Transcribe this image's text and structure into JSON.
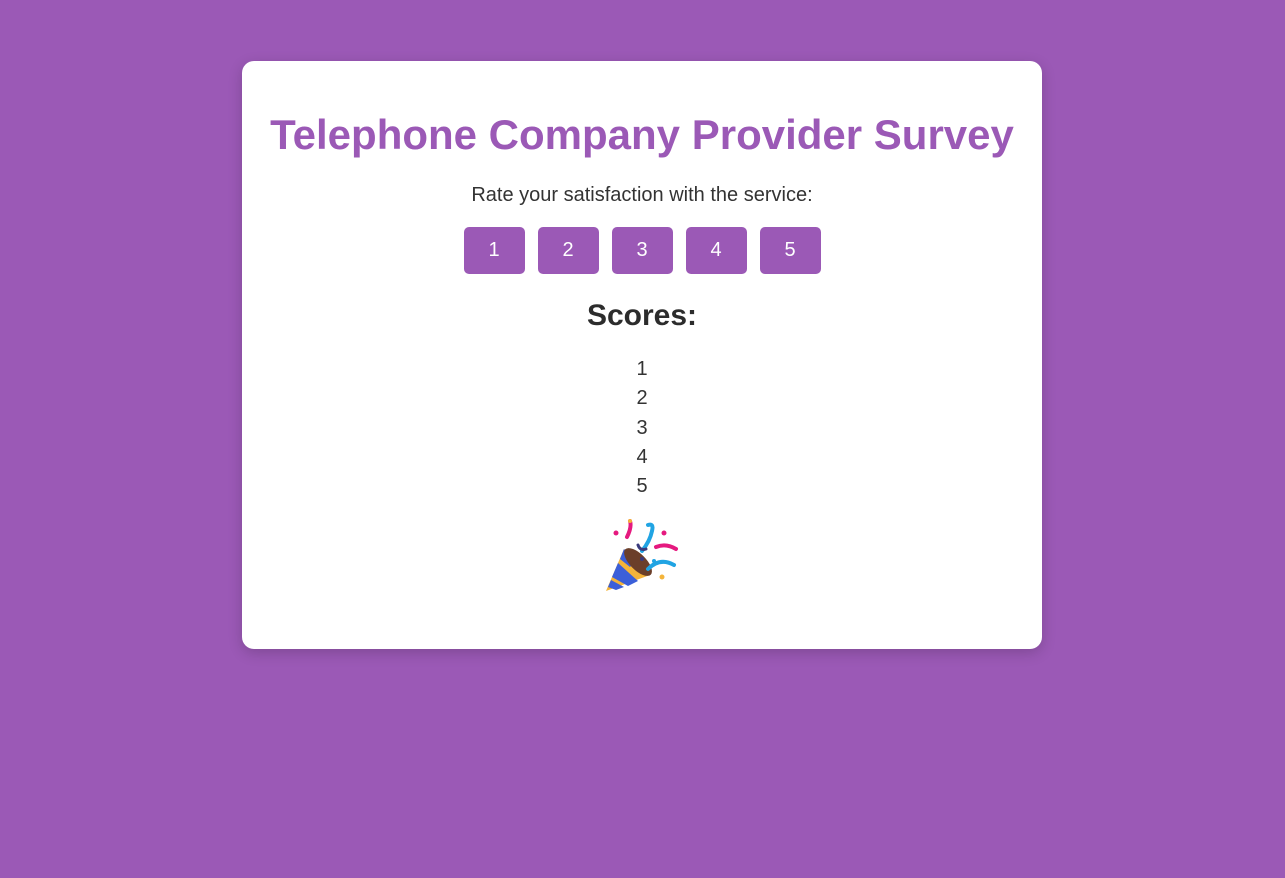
{
  "survey": {
    "title": "Telephone Company Provider Survey",
    "prompt": "Rate your satisfaction with the service:",
    "rating_buttons": [
      "1",
      "2",
      "3",
      "4",
      "5"
    ],
    "scores_heading": "Scores:",
    "scores": [
      "1",
      "2",
      "3",
      "4",
      "5"
    ],
    "celebration_icon": "party-popper-icon"
  },
  "colors": {
    "accent": "#9b59b6",
    "background": "#9b59b6",
    "card": "#ffffff",
    "text": "#333333"
  }
}
